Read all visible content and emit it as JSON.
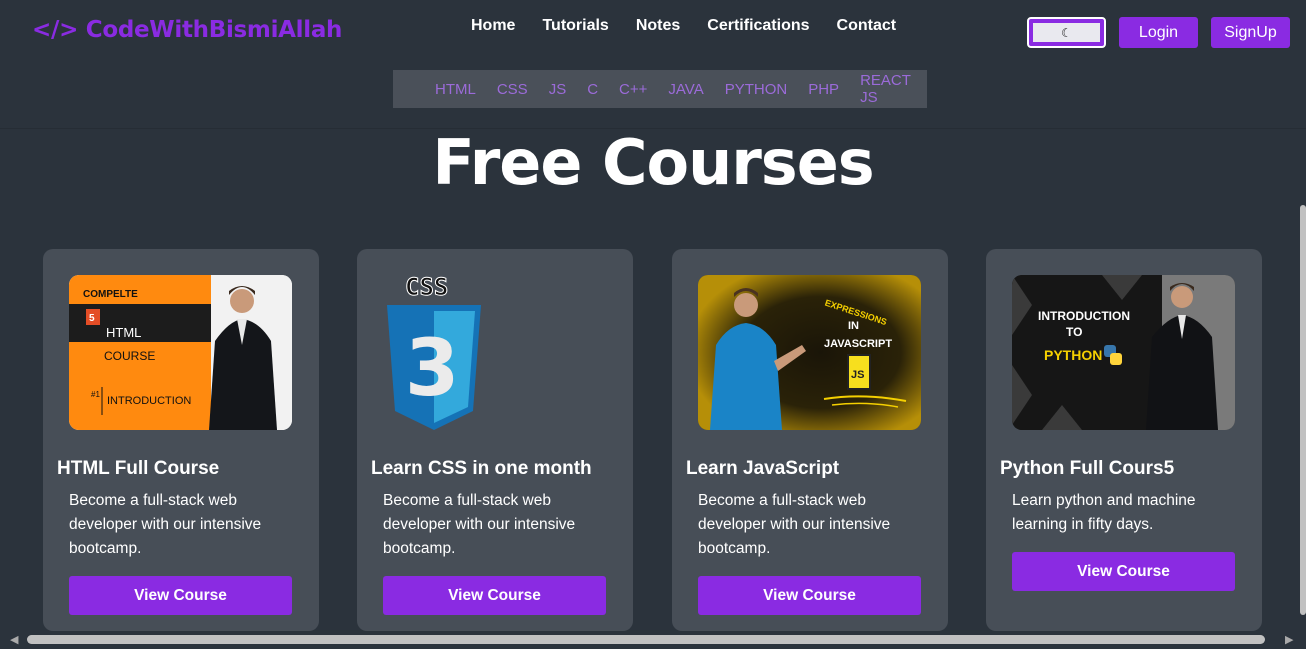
{
  "header": {
    "logo": "</> CodeWithBismiAllah",
    "nav": [
      "Home",
      "Tutorials",
      "Notes",
      "Certifications",
      "Contact"
    ],
    "theme_toggle_icon": "☾",
    "login": "Login",
    "signup": "SignUp"
  },
  "subnav": [
    "HTML",
    "CSS",
    "JS",
    "C",
    "C++",
    "JAVA",
    "PYTHON",
    "PHP",
    "REACT JS"
  ],
  "page_title": "Free Courses",
  "cards": [
    {
      "title": "HTML Full Course",
      "desc": "Become a full-stack web developer with our intensive bootcamp.",
      "button": "View Course",
      "thumb": {
        "l1": "COMPELTE",
        "badge": "5",
        "l2": "HTML",
        "l3": "COURSE",
        "num": "#1",
        "l4": "INTRODUCTION"
      }
    },
    {
      "title": "Learn CSS in one month",
      "desc": "Become a full-stack web developer with our intensive bootcamp.",
      "button": "View Course",
      "thumb": {
        "l1": "CSS",
        "badge": "3"
      }
    },
    {
      "title": "Learn JavaScript",
      "desc": "Become a full-stack web developer with our intensive bootcamp.",
      "button": "View Course",
      "thumb": {
        "l1": "EXPRESSIONS",
        "l2": "IN",
        "l3": "JAVASCRIPT",
        "badge": "JS"
      }
    },
    {
      "title": "Python Full Cours5",
      "desc": "Learn python and machine learning in fifty days.",
      "button": "View Course",
      "thumb": {
        "l1": "INTRODUCTION",
        "l2": "TO",
        "l3": "PYTHON"
      }
    }
  ],
  "colors": {
    "accent": "#8a2be2",
    "bg": "#2b333c",
    "card": "#474e57"
  }
}
